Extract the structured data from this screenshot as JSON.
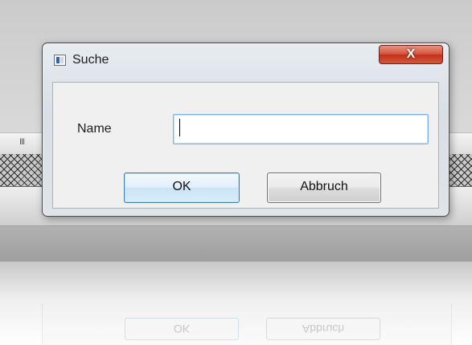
{
  "background": {
    "grip_glyph": "III",
    "reflection": {
      "ok_label": "OK",
      "cancel_label": "Abbruch"
    }
  },
  "dialog": {
    "title": "Suche",
    "close_glyph": "X",
    "name_label": "Name",
    "name_value": "",
    "ok_label": "OK",
    "cancel_label": "Abbruch",
    "icons": {
      "app": "window-app-icon",
      "close": "close-icon"
    },
    "colors": {
      "close_button": "#c7351f",
      "ok_border": "#3c7fb1",
      "input_focus_border": "#7eb4ea"
    }
  }
}
